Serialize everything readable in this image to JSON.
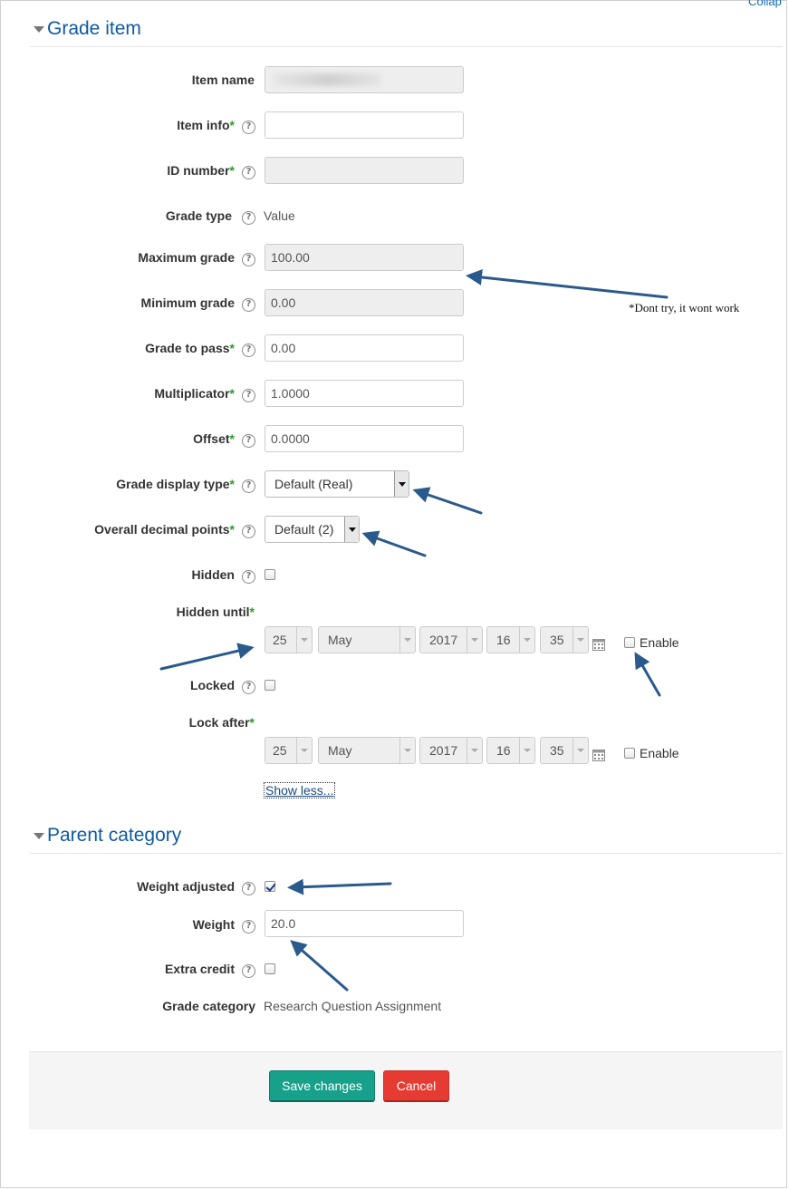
{
  "header": {
    "collapse_all": "Collap"
  },
  "grade_item": {
    "section_title": "Grade item",
    "item_name": {
      "label": "Item name",
      "value": ""
    },
    "item_info": {
      "label": "Item info",
      "value": ""
    },
    "id_number": {
      "label": "ID number",
      "value": ""
    },
    "grade_type": {
      "label": "Grade type",
      "value": "Value"
    },
    "maximum_grade": {
      "label": "Maximum grade",
      "value": "100.00"
    },
    "minimum_grade": {
      "label": "Minimum grade",
      "value": "0.00"
    },
    "grade_to_pass": {
      "label": "Grade to pass",
      "value": "0.00"
    },
    "multiplicator": {
      "label": "Multiplicator",
      "value": "1.0000"
    },
    "offset": {
      "label": "Offset",
      "value": "0.0000"
    },
    "grade_display_type": {
      "label": "Grade display type",
      "value": "Default (Real)"
    },
    "overall_decimal_points": {
      "label": "Overall decimal points",
      "value": "Default (2)"
    },
    "hidden": {
      "label": "Hidden",
      "checked": false
    },
    "hidden_until": {
      "label": "Hidden until",
      "day": "25",
      "month": "May",
      "year": "2017",
      "hour": "16",
      "minute": "35",
      "enable_label": "Enable",
      "enabled": false
    },
    "locked": {
      "label": "Locked",
      "checked": false
    },
    "lock_after": {
      "label": "Lock after",
      "day": "25",
      "month": "May",
      "year": "2017",
      "hour": "16",
      "minute": "35",
      "enable_label": "Enable",
      "enabled": false
    },
    "show_less": "Show less..."
  },
  "parent_category": {
    "section_title": "Parent category",
    "weight_adjusted": {
      "label": "Weight adjusted",
      "checked": true
    },
    "weight": {
      "label": "Weight",
      "value": "20.0"
    },
    "extra_credit": {
      "label": "Extra credit",
      "checked": false
    },
    "grade_category": {
      "label": "Grade category",
      "value": "Research Question Assignment"
    }
  },
  "buttons": {
    "save": "Save changes",
    "cancel": "Cancel"
  },
  "annotation": {
    "note": "*Dont try, it wont work",
    "arrow_color": "#2a5a8c"
  },
  "colors": {
    "link": "#0f5aa0",
    "required": "#2a9a2a",
    "save_bg": "#17a08a",
    "cancel_bg": "#e63b33"
  },
  "required_marker": "*",
  "help_glyph": "?"
}
